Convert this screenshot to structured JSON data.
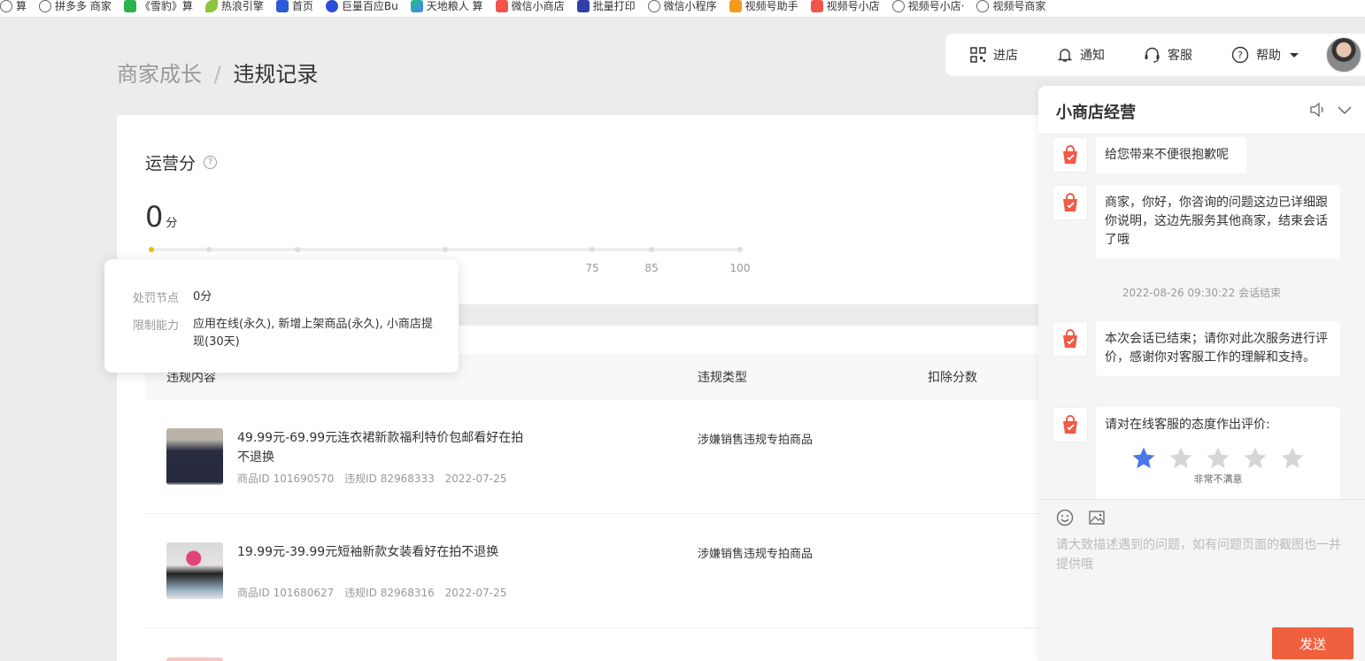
{
  "bookmarks": [
    {
      "label": "算",
      "icon": "globe-icon"
    },
    {
      "label": "拼多多 商家",
      "icon": "globe-icon"
    },
    {
      "label": "《雪豹》算",
      "icon": "green-icon"
    },
    {
      "label": "热浪引擎",
      "icon": "leaf-icon"
    },
    {
      "label": "首页",
      "icon": "blue-icon"
    },
    {
      "label": "巨量百应Bu",
      "icon": "bcircle-icon"
    },
    {
      "label": "天地粮人 算",
      "icon": "tri-icon"
    },
    {
      "label": "微信小商店",
      "icon": "red-icon"
    },
    {
      "label": "批量打印",
      "icon": "navy-icon"
    },
    {
      "label": "微信小程序",
      "icon": "globe-icon"
    },
    {
      "label": "视频号助手",
      "icon": "orange-icon"
    },
    {
      "label": "视频号小店",
      "icon": "red-icon"
    },
    {
      "label": "视频号小店·",
      "icon": "globe-icon"
    },
    {
      "label": "视频号商家",
      "icon": "globe-icon"
    }
  ],
  "breadcrumb": {
    "parent": "商家成长",
    "separator": "/",
    "current": "违规记录"
  },
  "topnav": {
    "enter_store": "进店",
    "notify": "通知",
    "service": "客服",
    "help": "帮助"
  },
  "score": {
    "title": "运营分",
    "value": "0",
    "unit": "分",
    "progress": 0,
    "tick_labels": [
      "75",
      "85",
      "100"
    ]
  },
  "tooltip": {
    "node_label": "处罚节点",
    "node_value": "0分",
    "limit_label": "限制能力",
    "limit_value": "应用在线(永久), 新增上架商品(永久), 小商店提现(30天)"
  },
  "table": {
    "headers": [
      "违规内容",
      "违规类型",
      "扣除分数"
    ],
    "rows": [
      {
        "title": "49.99元-69.99元连衣裙新款福利特价包邮看好在拍不退换",
        "product_id": "商品ID 101690570",
        "violation_id": "违规ID 82968333",
        "date": "2022-07-25",
        "type": "涉嫌销售违规专拍商品"
      },
      {
        "title": "19.99元-39.99元短袖新款女装看好在拍不退换",
        "product_id": "商品ID 101680627",
        "violation_id": "违规ID 82968316",
        "date": "2022-07-25",
        "type": "涉嫌销售违规专拍商品"
      }
    ]
  },
  "chat": {
    "title": "小商店经营",
    "messages": [
      {
        "text": "给您带来不便很抱歉呢"
      },
      {
        "text": "商家，你好，你咨询的问题这边已详细跟你说明，这边先服务其他商家，结束会话了哦"
      },
      {
        "text": "本次会话已结束；请你对此次服务进行评价，感谢你对客服工作的理解和支持。"
      }
    ],
    "system_msg": "2022-08-26 09:30:22 会话结束",
    "rating_prompt": "请对在线客服的态度作出评价:",
    "rating_value": 1,
    "rating_max": 5,
    "rating_label": "非常不满意",
    "star_active_color": "#4a78e8",
    "star_inactive_color": "#d6d6d6",
    "input_placeholder": "请大致描述遇到的问题，如有问题页面的截图也一并提供哦",
    "send_label": "发送"
  }
}
